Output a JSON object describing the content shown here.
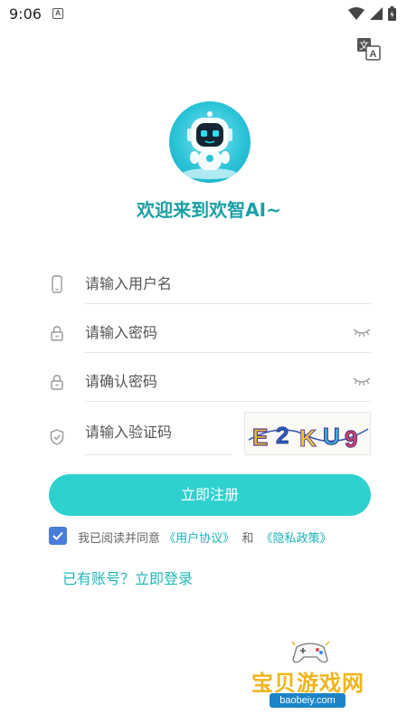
{
  "status_bar": {
    "time": "9:06",
    "notification_letter": "A",
    "icons": [
      "wifi-icon",
      "cell-signal-icon",
      "battery-icon"
    ]
  },
  "translate_icon": "translate-icon",
  "brand": {
    "welcome_text": "欢迎来到欢智AI~",
    "accent_color": "#2fd1cf",
    "title_color": "#1aa0a6"
  },
  "form": {
    "username": {
      "placeholder": "请输入用户名",
      "value": "",
      "icon": "phone-icon"
    },
    "password": {
      "placeholder": "请输入密码",
      "value": "",
      "icon": "lock-icon",
      "toggle_icon": "eye-closed-icon"
    },
    "confirm_password": {
      "placeholder": "请确认密码",
      "value": "",
      "icon": "lock-icon",
      "toggle_icon": "eye-closed-icon"
    },
    "captcha": {
      "placeholder": "请输入验证码",
      "value": "",
      "icon": "shield-icon",
      "image_text": "E2KU9"
    }
  },
  "register_button": "立即注册",
  "agreement": {
    "checked": true,
    "prefix": "我已阅读并同意",
    "user_agreement": "《用户协议》",
    "and": "和",
    "privacy_policy": "《隐私政策》"
  },
  "login_link": "已有账号？立即登录",
  "watermark": {
    "title": "宝贝游戏网",
    "url": "baobeiy.com"
  }
}
